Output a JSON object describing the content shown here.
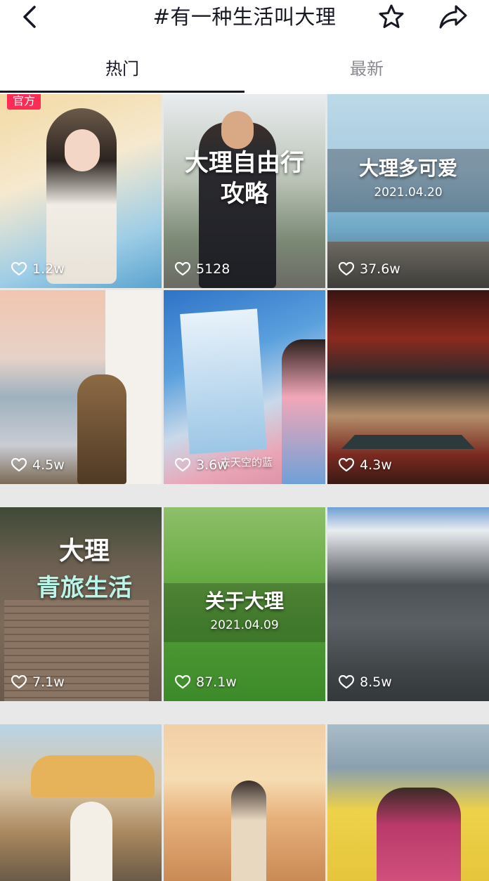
{
  "header": {
    "title": "#有一种生活叫大理",
    "back_icon": "chevron-left-icon",
    "favorite_icon": "star-icon",
    "share_icon": "share-icon"
  },
  "tabs": [
    {
      "label": "热门",
      "active": true
    },
    {
      "label": "最新",
      "active": false
    }
  ],
  "videos": [
    {
      "likes": "1.2w",
      "badge": "官方",
      "overlay": ""
    },
    {
      "likes": "5128",
      "overlay": "大理自由行\n攻略"
    },
    {
      "likes": "37.6w",
      "overlay": "大理多可爱",
      "date": "2021.04.20"
    },
    {
      "likes": "4.5w",
      "overlay": ""
    },
    {
      "likes": "3.6w",
      "overlay": "",
      "caption": "去天空的蓝"
    },
    {
      "likes": "4.3w",
      "overlay": ""
    },
    {
      "likes": "7.1w",
      "overlay": "大理",
      "overlay2": "青旅生活"
    },
    {
      "likes": "87.1w",
      "overlay": "关于大理",
      "date": "2021.04.09"
    },
    {
      "likes": "8.5w",
      "overlay": ""
    },
    {
      "likes": "",
      "overlay": ""
    },
    {
      "likes": "",
      "overlay": ""
    },
    {
      "likes": "",
      "overlay": ""
    }
  ],
  "colors": {
    "text_primary": "#161823",
    "text_secondary": "#8a8b91",
    "badge": "#fe2c55"
  }
}
